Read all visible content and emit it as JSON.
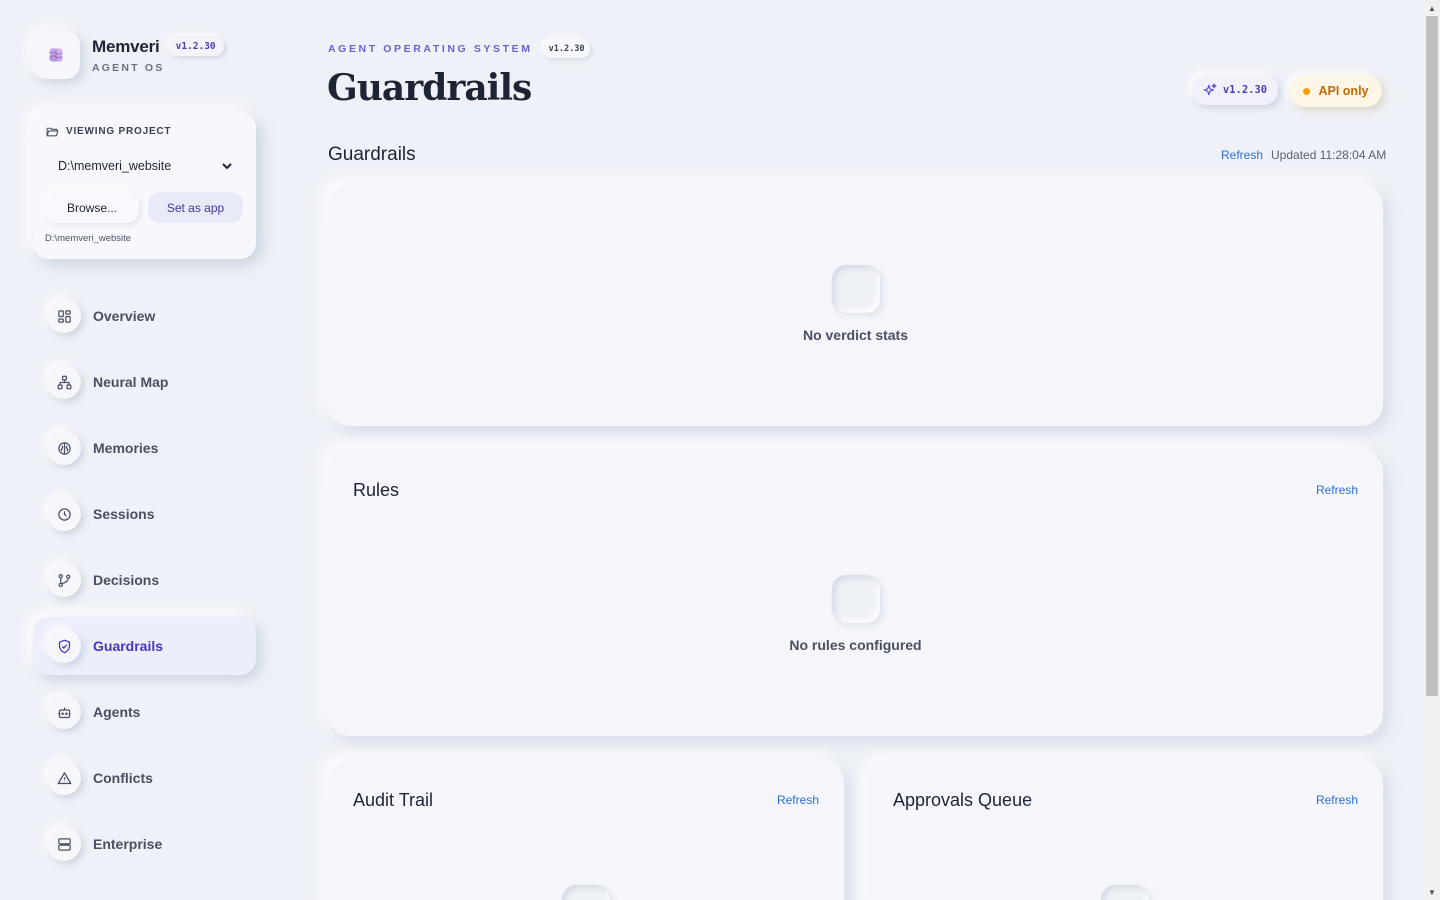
{
  "brand": {
    "name": "Memveri",
    "version": "v1.2.30",
    "subtitle": "AGENT OS"
  },
  "project": {
    "label": "VIEWING PROJECT",
    "selected": "D:\\memveri_website",
    "browse_label": "Browse...",
    "set_app_label": "Set as app",
    "path": "D:\\memveri_website"
  },
  "nav": {
    "items": [
      {
        "label": "Overview",
        "icon": "grid-icon"
      },
      {
        "label": "Neural Map",
        "icon": "network-icon"
      },
      {
        "label": "Memories",
        "icon": "brain-icon"
      },
      {
        "label": "Sessions",
        "icon": "clock-icon"
      },
      {
        "label": "Decisions",
        "icon": "git-branch-icon"
      },
      {
        "label": "Guardrails",
        "icon": "shield-icon",
        "active": true
      },
      {
        "label": "Agents",
        "icon": "bot-icon"
      },
      {
        "label": "Conflicts",
        "icon": "warning-icon"
      },
      {
        "label": "Enterprise",
        "icon": "server-icon"
      }
    ]
  },
  "header": {
    "eyebrow": "AGENT OPERATING SYSTEM",
    "eyebrow_version": "v1.2.30",
    "title": "Guardrails",
    "version_badge": "v1.2.30",
    "api_badge": "API only"
  },
  "section": {
    "title": "Guardrails",
    "refresh": "Refresh",
    "updated": "Updated 11:28:04 AM"
  },
  "verdict_card": {
    "empty_text": "No verdict stats"
  },
  "rules_card": {
    "title": "Rules",
    "refresh": "Refresh",
    "empty_text": "No rules configured"
  },
  "audit_card": {
    "title": "Audit Trail",
    "refresh": "Refresh"
  },
  "approvals_card": {
    "title": "Approvals Queue",
    "refresh": "Refresh"
  },
  "colors": {
    "accent": "#4337c4",
    "link": "#2f6fd1",
    "warning": "#f59e0b",
    "background": "#eef1f7"
  }
}
